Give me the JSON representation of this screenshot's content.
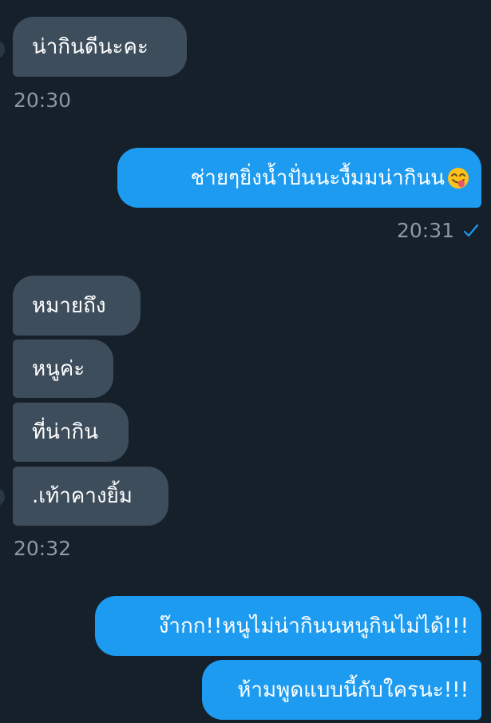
{
  "messages": {
    "m1": "น่ากินดีนะคะ",
    "t1": "20:30",
    "m2": "ช่ายๆยิ่งน้ำปั่นนะงื้มมน่ากินน",
    "t2": "20:31",
    "m3": "หมายถึง",
    "m4": "หนูค่ะ",
    "m5": "ที่น่ากิน",
    "m6": ".เท้าคางยิ้ม",
    "t3": "20:32",
    "m7": "ง๊ากก!!หนูไม่น่ากินนหนูกินไม่ได้!!!",
    "m8": "ห้ามพูดแบบนี้กับใครนะ!!!"
  },
  "icons": {
    "emoji": "face-savoring-food-icon",
    "delivered": "check-icon"
  },
  "colors": {
    "background": "#15202b",
    "incoming_bubble": "#3d4d5c",
    "outgoing_bubble": "#1d9bf0",
    "timestamp": "#8b98a5"
  }
}
